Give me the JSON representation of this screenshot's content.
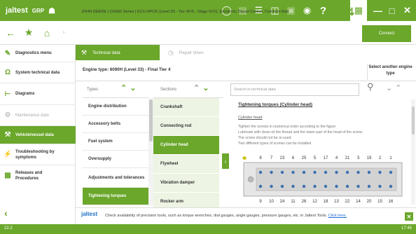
{
  "app": {
    "logo": "jaltest",
    "group": "GRP"
  },
  "toolbar": {
    "icons": [
      "globe-icon",
      "document-icon",
      "list-icon",
      "print-icon",
      "film-icon",
      "camera-icon",
      "help-icon"
    ],
    "help_label": "?"
  },
  "breadcrumb": "JOHN DEERE  |  CH500 Series  |  ECU HPCR (Level 33 - Tier 4F/5 - Stage IV/V), Electronic Diesel Control, Common Rail",
  "connect_label": "Connect",
  "sidebar": {
    "items": [
      {
        "label": "Diagnostics menu",
        "icon": "diagnostics-icon",
        "state": "normal"
      },
      {
        "label": "System technical data",
        "icon": "omega-icon",
        "state": "normal"
      },
      {
        "label": "Diagrams",
        "icon": "diagram-icon",
        "state": "normal"
      },
      {
        "label": "Maintenance data",
        "icon": "maintenance-icon",
        "state": "dim"
      },
      {
        "label": "Vehicle/vessel data",
        "icon": "wrench-icon",
        "state": "active"
      },
      {
        "label": "Troubleshooting by symptoms",
        "icon": "troubleshooting-icon",
        "state": "normal"
      },
      {
        "label": "Releases and Procedures",
        "icon": "procedures-icon",
        "state": "normal"
      }
    ]
  },
  "tabs": {
    "technical_data": "Technical data",
    "repair_times": "Repair times"
  },
  "engine": {
    "type_label": "Engine type:  6090H (Level 33) - Final Tier 4",
    "select_another": "Select another engine type"
  },
  "columns": {
    "types_header": "Types",
    "sections_header": "Sections"
  },
  "types": [
    {
      "label": "Engine distribution",
      "active": false
    },
    {
      "label": "Accessory belts",
      "active": false
    },
    {
      "label": "Fuel system",
      "active": false
    },
    {
      "label": "Oversupply",
      "active": false
    },
    {
      "label": "Adjustments and tolerances",
      "active": false
    },
    {
      "label": "Tightening torques",
      "active": true
    }
  ],
  "sections": [
    {
      "label": "Crankshaft",
      "active": false
    },
    {
      "label": "Connecting rod",
      "active": false
    },
    {
      "label": "Cylinder head",
      "active": true
    },
    {
      "label": "Flywheel",
      "active": false
    },
    {
      "label": "Vibration damper",
      "active": false
    },
    {
      "label": "Rocker arm",
      "active": false
    }
  ],
  "search": {
    "placeholder": "Search in technical data"
  },
  "document": {
    "title": "Tightening torques (Cylinder head)",
    "subtitle": "Cylinder head",
    "lines": [
      "Tighten the screws in numerical order according to the figure",
      "Lubricate with clean oil the thread and the lower part of the head of the screw",
      "The screw should not be re-used",
      "Two different types of screws can be installed"
    ],
    "top_numbers": [
      "8",
      "7",
      "23",
      "6",
      "25",
      "5",
      "17",
      "4",
      "21",
      "3",
      "19",
      "2",
      "1"
    ],
    "bottom_numbers": [
      "9",
      "10",
      "24",
      "11",
      "26",
      "12",
      "18",
      "13",
      "22",
      "14",
      "20",
      "15",
      "16"
    ]
  },
  "footer": {
    "logo": "jaltest",
    "text": "Check availability of precision tools, such as torque wrenches, dial gauges, angle gauges, pressure gauges, etc. in Jaltest Tools.",
    "link": "Click here."
  },
  "status": {
    "left": "22.2",
    "right": "17:45"
  },
  "colors": {
    "brand_green": "#6aa72b",
    "light_green": "#edf4e3"
  }
}
